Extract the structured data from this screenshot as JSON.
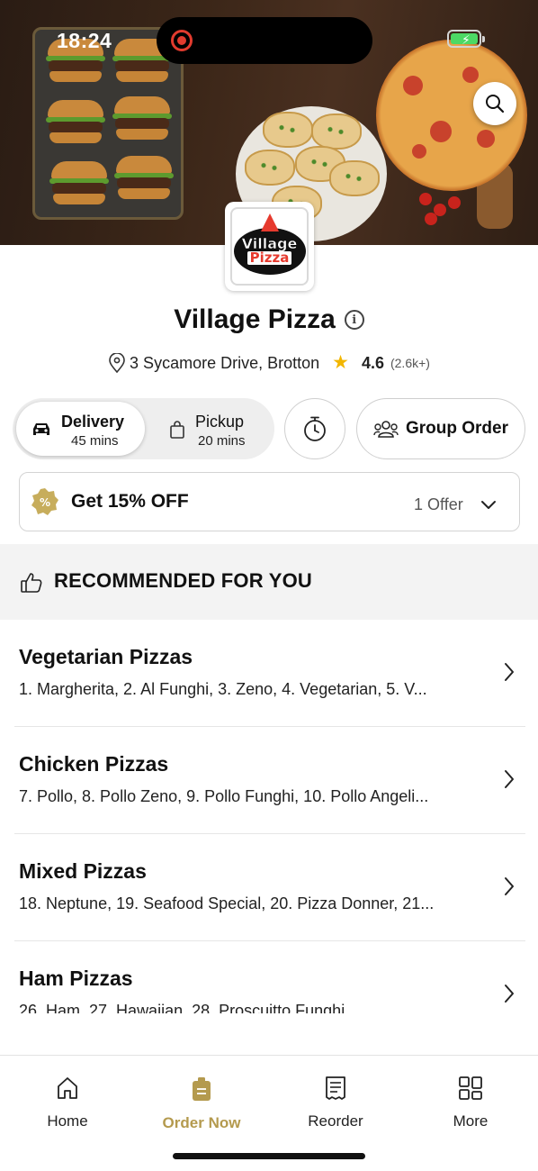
{
  "status_bar": {
    "time": "18:24"
  },
  "restaurant": {
    "logo_text_1": "Village",
    "logo_text_2": "Pizza",
    "name": "Village Pizza",
    "address": "3 Sycamore Drive, Brotton",
    "rating": "4.6",
    "rating_count": "(2.6k+)"
  },
  "order_mode": {
    "delivery": {
      "label": "Delivery",
      "time": "45 mins",
      "selected": true
    },
    "pickup": {
      "label": "Pickup",
      "time": "20 mins",
      "selected": false
    },
    "group_order_label": "Group Order"
  },
  "offer": {
    "title": "Get 15% OFF",
    "count": "1 Offer",
    "badge_symbol": "%"
  },
  "recommended": {
    "title": "RECOMMENDED FOR YOU"
  },
  "categories": [
    {
      "title": "Vegetarian Pizzas",
      "items": "1. Margherita, 2. Al Funghi, 3. Zeno, 4. Vegetarian, 5. V..."
    },
    {
      "title": "Chicken Pizzas",
      "items": "7. Pollo, 8. Pollo Zeno, 9. Pollo Funghi, 10. Pollo Angeli..."
    },
    {
      "title": "Mixed Pizzas",
      "items": "18. Neptune, 19. Seafood Special, 20. Pizza Donner, 21..."
    },
    {
      "title": "Ham Pizzas",
      "items": "26. Ham, 27. Hawaiian, 28. Proscuitto Funghi"
    }
  ],
  "tabs": [
    {
      "label": "Home",
      "icon": "home-icon"
    },
    {
      "label": "Order Now",
      "icon": "order-now-icon",
      "active": true
    },
    {
      "label": "Reorder",
      "icon": "receipt-icon"
    },
    {
      "label": "More",
      "icon": "grid-icon"
    }
  ],
  "colors": {
    "accent": "#b49a4e",
    "star": "#f2b600",
    "offer_badge": "#c7ad5c"
  }
}
